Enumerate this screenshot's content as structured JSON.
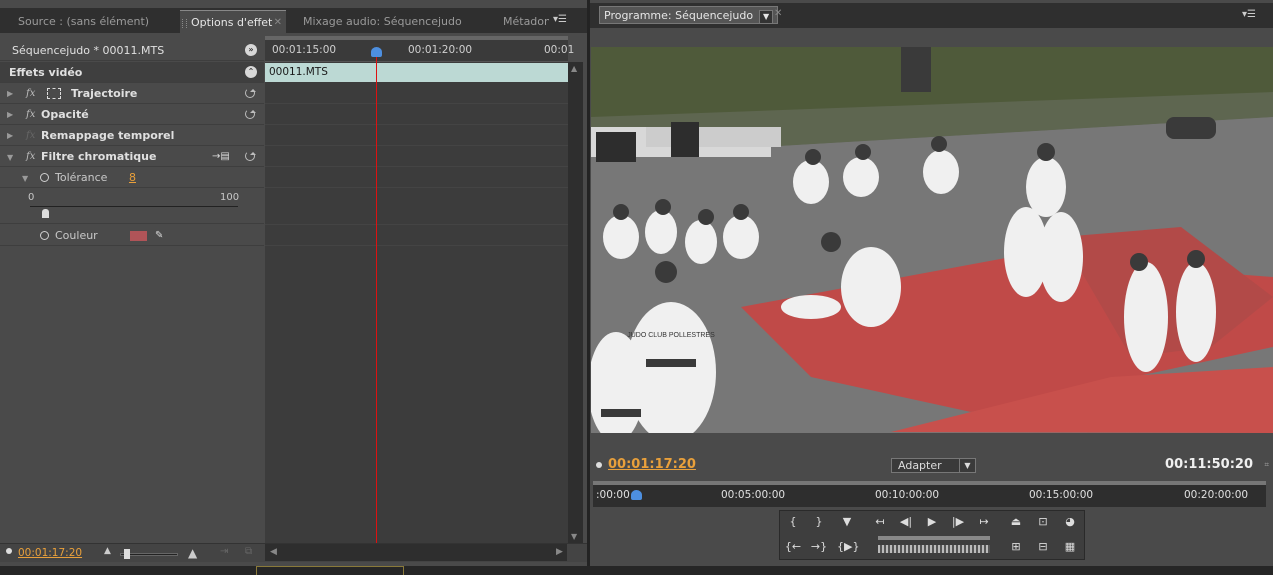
{
  "left_panel": {
    "tabs": [
      {
        "label": "Source : (sans élément)"
      },
      {
        "label": "Options d'effet"
      },
      {
        "label": "Mixage audio: Séquencejudo"
      },
      {
        "label": "Métadon"
      }
    ],
    "sequence_header": "Séquencejudo * 00011.MTS",
    "section_title": "Effets vidéo",
    "effects": [
      {
        "label": "Trajectoire"
      },
      {
        "label": "Opacité"
      },
      {
        "label": "Remappage temporel"
      },
      {
        "label": "Filtre chromatique"
      }
    ],
    "tolerance": {
      "label": "Tolérance",
      "value": "8",
      "min": "0",
      "max": "100"
    },
    "color": {
      "label": "Couleur",
      "swatch": "#b05458"
    },
    "fx_label": "fx",
    "timeline": {
      "ticks": [
        "00:01:15:00",
        "00:01:20:00",
        "00:01"
      ],
      "clip_name": "00011.MTS"
    },
    "current_time": "00:01:17:20"
  },
  "right_panel": {
    "tab_title": "Programme: Séquencejudo",
    "current_time": "00:01:17:20",
    "duration": "00:11:50:20",
    "fit_option": "Adapter",
    "ruler_ticks": [
      ":00:00",
      "00:05:00:00",
      "00:10:00:00",
      "00:15:00:00",
      "00:20:00:00"
    ],
    "video_text": "JUDO CLUB POLLESTRES"
  },
  "colors": {
    "accent_orange": "#e9a03b",
    "playhead_red": "#d11111",
    "clip_cyan": "#bcd9d4"
  }
}
